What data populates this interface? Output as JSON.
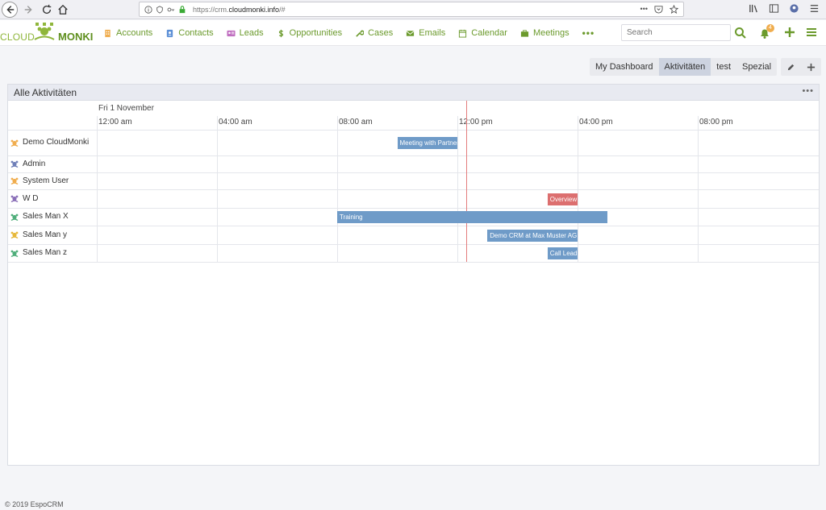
{
  "browser": {
    "url_prefix": "https://crm.",
    "url_domain": "cloudmonki.info",
    "url_suffix": "/#",
    "dots": "•••"
  },
  "logo": {
    "part_a": "CLOUD",
    "part_b": "MONKI"
  },
  "nav": {
    "items": [
      {
        "label": "Accounts",
        "icon": "building-icon",
        "color": "#f0ad4e"
      },
      {
        "label": "Contacts",
        "icon": "contact-card-icon",
        "color": "#5b8fd6"
      },
      {
        "label": "Leads",
        "icon": "lead-card-icon",
        "color": "#c06fc0"
      },
      {
        "label": "Opportunities",
        "icon": "dollar-icon",
        "color": "#6b9a2c"
      },
      {
        "label": "Cases",
        "icon": "wrench-icon",
        "color": "#6b9a2c"
      },
      {
        "label": "Emails",
        "icon": "envelope-icon",
        "color": "#6b9a2c"
      },
      {
        "label": "Calendar",
        "icon": "calendar-icon",
        "color": "#6b9a2c"
      },
      {
        "label": "Meetings",
        "icon": "briefcase-icon",
        "color": "#6b9a2c"
      }
    ],
    "more": "•••",
    "search_placeholder": "Search",
    "notification_count": "4"
  },
  "dashboard": {
    "tabs": [
      "My Dashboard",
      "Aktivitäten",
      "test",
      "Spezial"
    ],
    "active_tab": "Aktivitäten"
  },
  "panel": {
    "title": "Alle Aktivitäten",
    "menu": "•••",
    "date": "Fri 1 November",
    "times": [
      "12:00 am",
      "04:00 am",
      "08:00 am",
      "12:00 pm",
      "04:00 pm",
      "08:00 pm"
    ],
    "rows": [
      {
        "label": "Demo CloudMonki",
        "icon": "monkey-orange-icon",
        "color": "#f0ad4e"
      },
      {
        "label": "Admin",
        "icon": "monkey-blue-icon",
        "color": "#6f7fb8"
      },
      {
        "label": "System User",
        "icon": "monkey-orange-icon",
        "color": "#f0ad4e"
      },
      {
        "label": "W D",
        "icon": "monkey-purple-icon",
        "color": "#8a6fb8"
      },
      {
        "label": "Sales Man X",
        "icon": "monkey-green-icon",
        "color": "#4fae7a"
      },
      {
        "label": "Sales Man y",
        "icon": "monkey-yellow-icon",
        "color": "#e6b83a"
      },
      {
        "label": "Sales Man z",
        "icon": "monkey-green-icon",
        "color": "#4fae7a"
      }
    ],
    "events": [
      {
        "row": 0,
        "label": "Meeting with Partner",
        "start_hour": 10.0,
        "end_hour": 12.0,
        "color": "#6f9bc8"
      },
      {
        "row": 3,
        "label": "Overview",
        "start_hour": 15.0,
        "end_hour": 16.0,
        "color": "#dc6f6f"
      },
      {
        "row": 4,
        "label": "Training",
        "start_hour": 8.0,
        "end_hour": 17.0,
        "color": "#6f9bc8"
      },
      {
        "row": 5,
        "label": "Demo CRM at Max Muster AG",
        "start_hour": 13.0,
        "end_hour": 16.0,
        "color": "#6f9bc8"
      },
      {
        "row": 6,
        "label": "Call Lead",
        "start_hour": 15.0,
        "end_hour": 16.0,
        "color": "#6f9bc8"
      }
    ],
    "now_hour": 12.3
  },
  "footer": {
    "text": "© 2019 EspoCRM"
  }
}
